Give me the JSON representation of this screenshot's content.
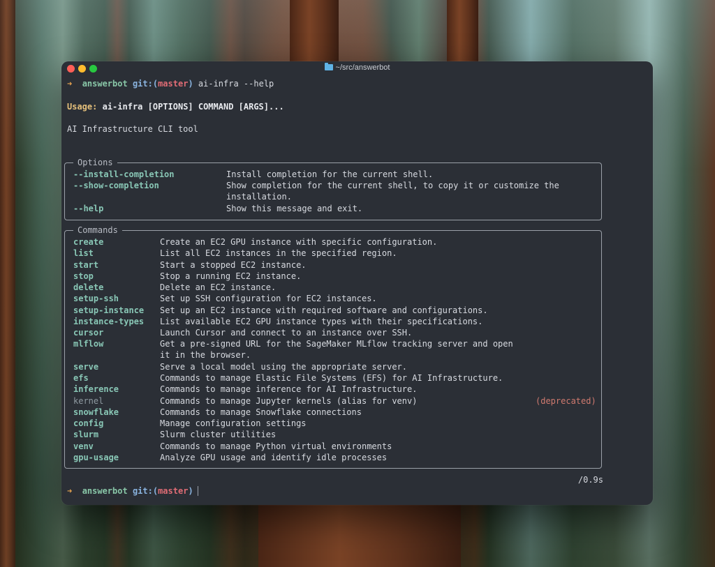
{
  "window": {
    "title": "~/src/answerbot"
  },
  "prompt1": {
    "arrow": "➜",
    "dir": "answerbot",
    "git": "git:(",
    "branch": "master",
    "git_close": ")",
    "command": "ai-infra --help"
  },
  "usage": {
    "label": "Usage:",
    "text": "ai-infra [OPTIONS] COMMAND [ARGS]..."
  },
  "description": "AI Infrastructure CLI tool",
  "options": {
    "title": "Options",
    "items": [
      {
        "name": "--install-completion",
        "desc": "Install completion for the current shell."
      },
      {
        "name": "--show-completion",
        "desc": "Show completion for the current shell, to copy it or customize the",
        "desc2": "installation."
      },
      {
        "name": "--help",
        "desc": "Show this message and exit."
      }
    ]
  },
  "commands": {
    "title": "Commands",
    "items": [
      {
        "name": "create",
        "desc": "Create an EC2 GPU instance with specific configuration."
      },
      {
        "name": "list",
        "desc": "List all EC2 instances in the specified region."
      },
      {
        "name": "start",
        "desc": "Start a stopped EC2 instance."
      },
      {
        "name": "stop",
        "desc": "Stop a running EC2 instance."
      },
      {
        "name": "delete",
        "desc": "Delete an EC2 instance."
      },
      {
        "name": "setup-ssh",
        "desc": "Set up SSH configuration for EC2 instances."
      },
      {
        "name": "setup-instance",
        "desc": "Set up an EC2 instance with required software and configurations."
      },
      {
        "name": "instance-types",
        "desc": "List available EC2 GPU instance types with their specifications."
      },
      {
        "name": "cursor",
        "desc": "Launch Cursor and connect to an instance over SSH."
      },
      {
        "name": "mlflow",
        "desc": "Get a pre-signed URL for the SageMaker MLflow tracking server and open",
        "desc2": "it in the browser."
      },
      {
        "name": "serve",
        "desc": "Serve a local model using the appropriate server."
      },
      {
        "name": "efs",
        "desc": "Commands to manage Elastic File Systems (EFS) for AI Infrastructure."
      },
      {
        "name": "inference",
        "desc": "Commands to manage inference for AI Infrastructure."
      },
      {
        "name": "kernel",
        "desc": "Commands to manage Jupyter kernels (alias for venv)",
        "tag": "(deprecated)"
      },
      {
        "name": "snowflake",
        "desc": "Commands to manage Snowflake connections"
      },
      {
        "name": "config",
        "desc": "Manage configuration settings"
      },
      {
        "name": "slurm",
        "desc": "Slurm cluster utilities"
      },
      {
        "name": "venv",
        "desc": "Commands to manage Python virtual environments"
      },
      {
        "name": "gpu-usage",
        "desc": "Analyze GPU usage and identify idle processes"
      }
    ]
  },
  "timing": "/0.9s",
  "prompt2": {
    "arrow": "➜",
    "dir": "answerbot",
    "git": "git:(",
    "branch": "master",
    "git_close": ")"
  }
}
